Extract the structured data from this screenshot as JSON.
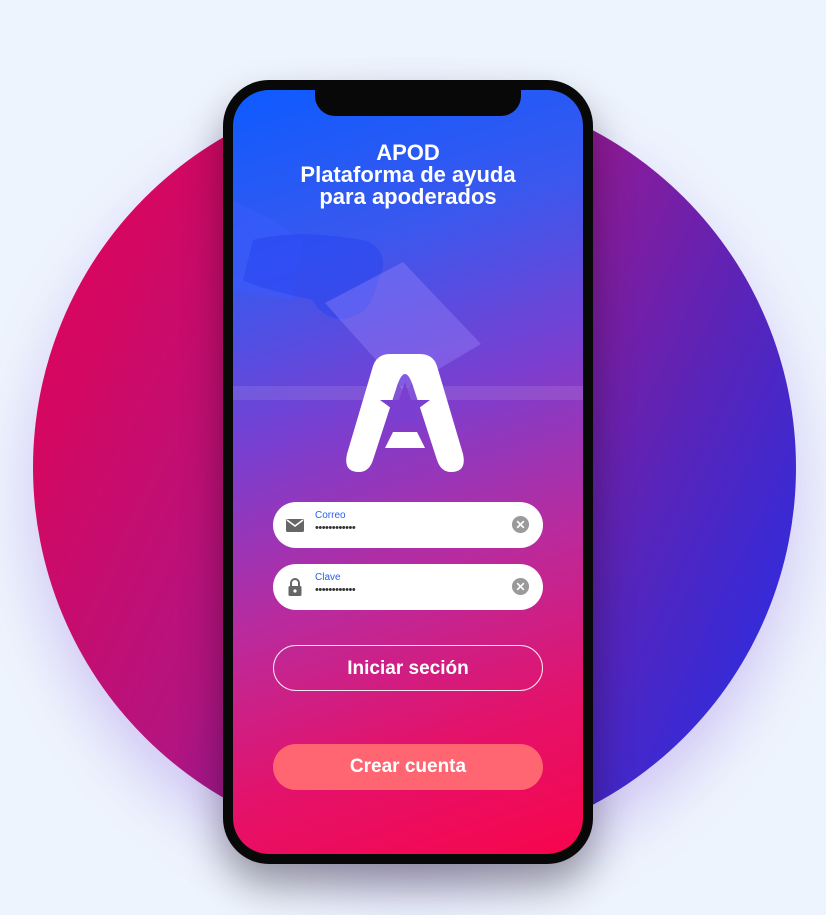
{
  "app": {
    "title_line1": "APOD",
    "title_line2": "Plataforma de ayuda",
    "title_line3": "para apoderados"
  },
  "form": {
    "email": {
      "label": "Correo",
      "value": "••••••••••••",
      "icon": "mail-icon"
    },
    "password": {
      "label": "Clave",
      "value": "••••••••••••",
      "icon": "lock-icon"
    }
  },
  "buttons": {
    "login": "Iniciar seción",
    "register": "Crear cuenta"
  },
  "colors": {
    "accent_button": "#ff6672",
    "gradient_top": "#0d5bff",
    "gradient_bottom": "#f7054c",
    "field_label": "#2a5ee6"
  }
}
